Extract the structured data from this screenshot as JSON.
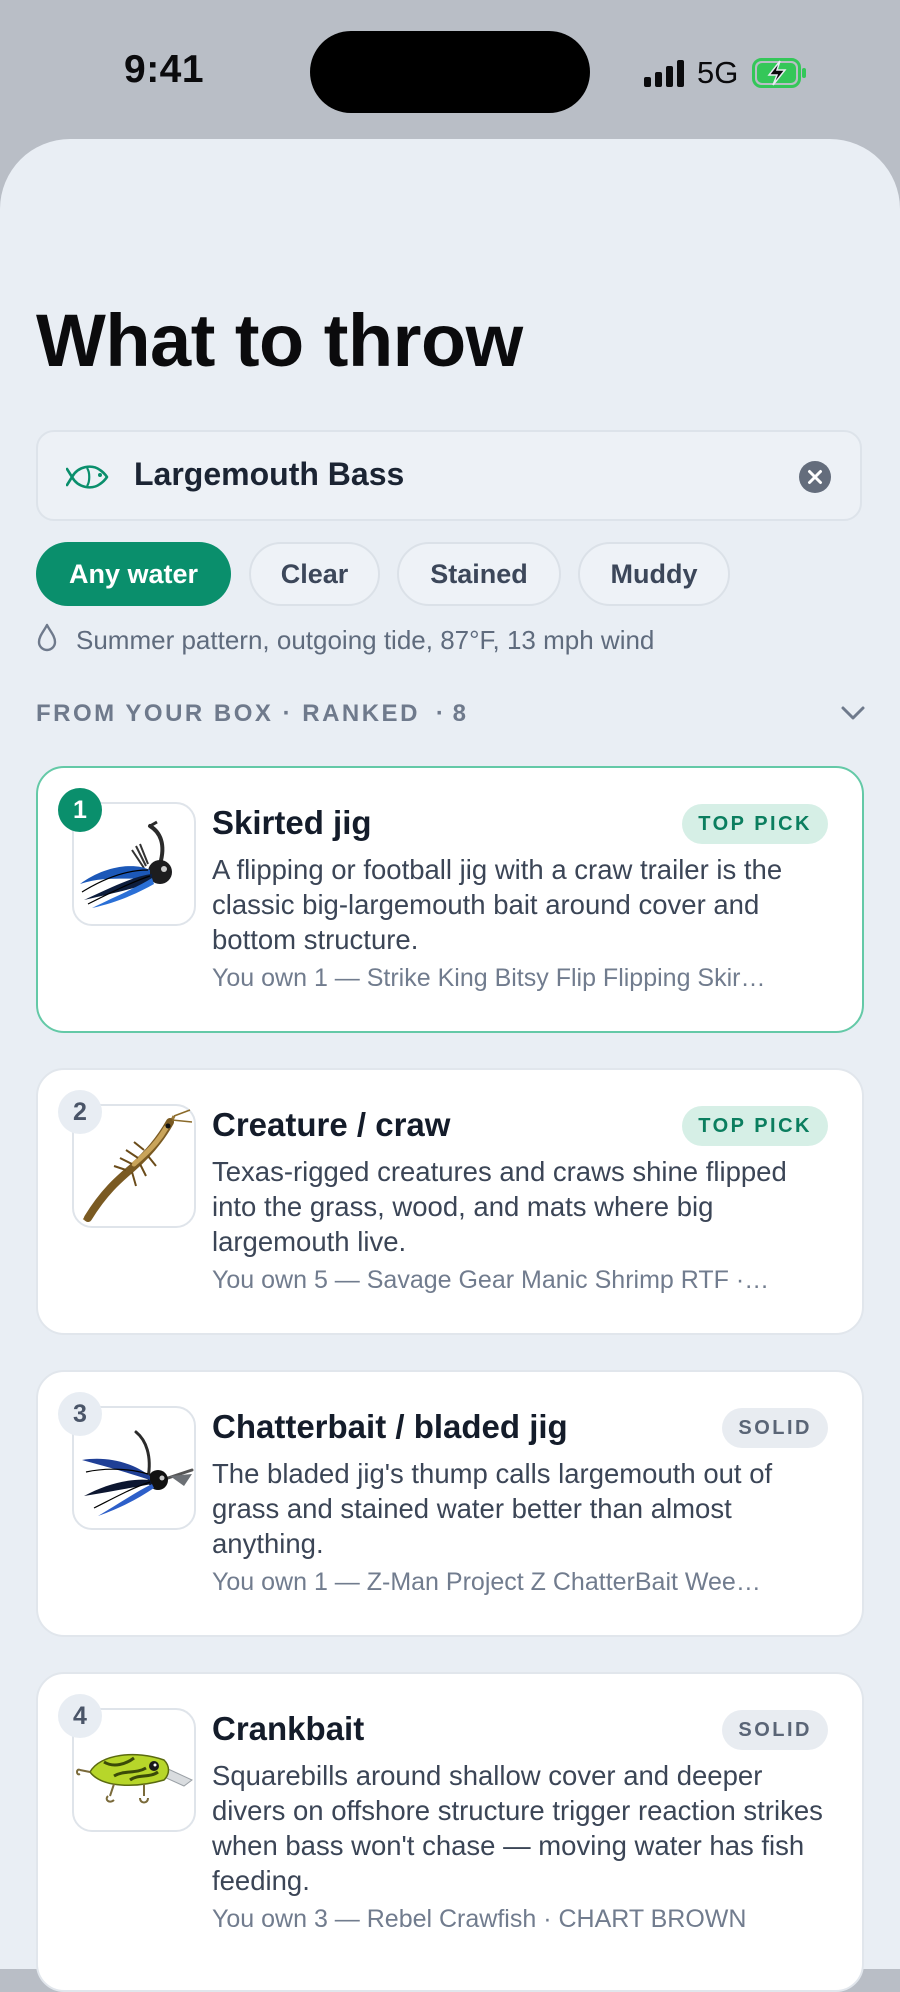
{
  "status_bar": {
    "time": "9:41",
    "network": "5G"
  },
  "header": {
    "title": "What to throw"
  },
  "search": {
    "value": "Largemouth Bass",
    "icon": "fish-icon",
    "clear_icon": "clear-icon"
  },
  "filters": [
    {
      "label": "Any water",
      "selected": true
    },
    {
      "label": "Clear",
      "selected": false
    },
    {
      "label": "Stained",
      "selected": false
    },
    {
      "label": "Muddy",
      "selected": false
    }
  ],
  "conditions": {
    "icon": "water-drop-icon",
    "text": "Summer pattern, outgoing tide, 87°F, 13 mph wind"
  },
  "section": {
    "label": "FROM YOUR BOX · RANKED",
    "count": "· 8"
  },
  "lures": [
    {
      "rank": "1",
      "name": "Skirted jig",
      "badge": "TOP PICK",
      "description": "A flipping or football jig with a craw trailer is the classic big-largemouth bait around cover and bottom structure.",
      "owned": "You own 1 — Strike King Bitsy Flip Flipping Skir…"
    },
    {
      "rank": "2",
      "name": "Creature / craw",
      "badge": "TOP PICK",
      "description": "Texas-rigged creatures and craws shine flipped into the grass, wood, and mats where big largemouth live.",
      "owned": "You own 5 — Savage Gear Manic Shrimp RTF ·…"
    },
    {
      "rank": "3",
      "name": "Chatterbait / bladed jig",
      "badge": "SOLID",
      "description": "The bladed jig's thump calls largemouth out of grass and stained water better than almost anything.",
      "owned": "You own 1 — Z-Man Project Z ChatterBait Wee…"
    },
    {
      "rank": "4",
      "name": "Crankbait",
      "badge": "SOLID",
      "description": "Squarebills around shallow cover and deeper divers on offshore structure trigger reaction strikes when bass won't chase — moving water has fish feeding.",
      "owned": "You own 3 — Rebel Crawfish · CHART BROWN"
    }
  ],
  "colors": {
    "accent": "#0a8f6c",
    "background": "#e9eef4",
    "top_pick_badge": "#d6efe6",
    "solid_badge": "#e8ecf1",
    "battery_charging": "#34c759"
  }
}
